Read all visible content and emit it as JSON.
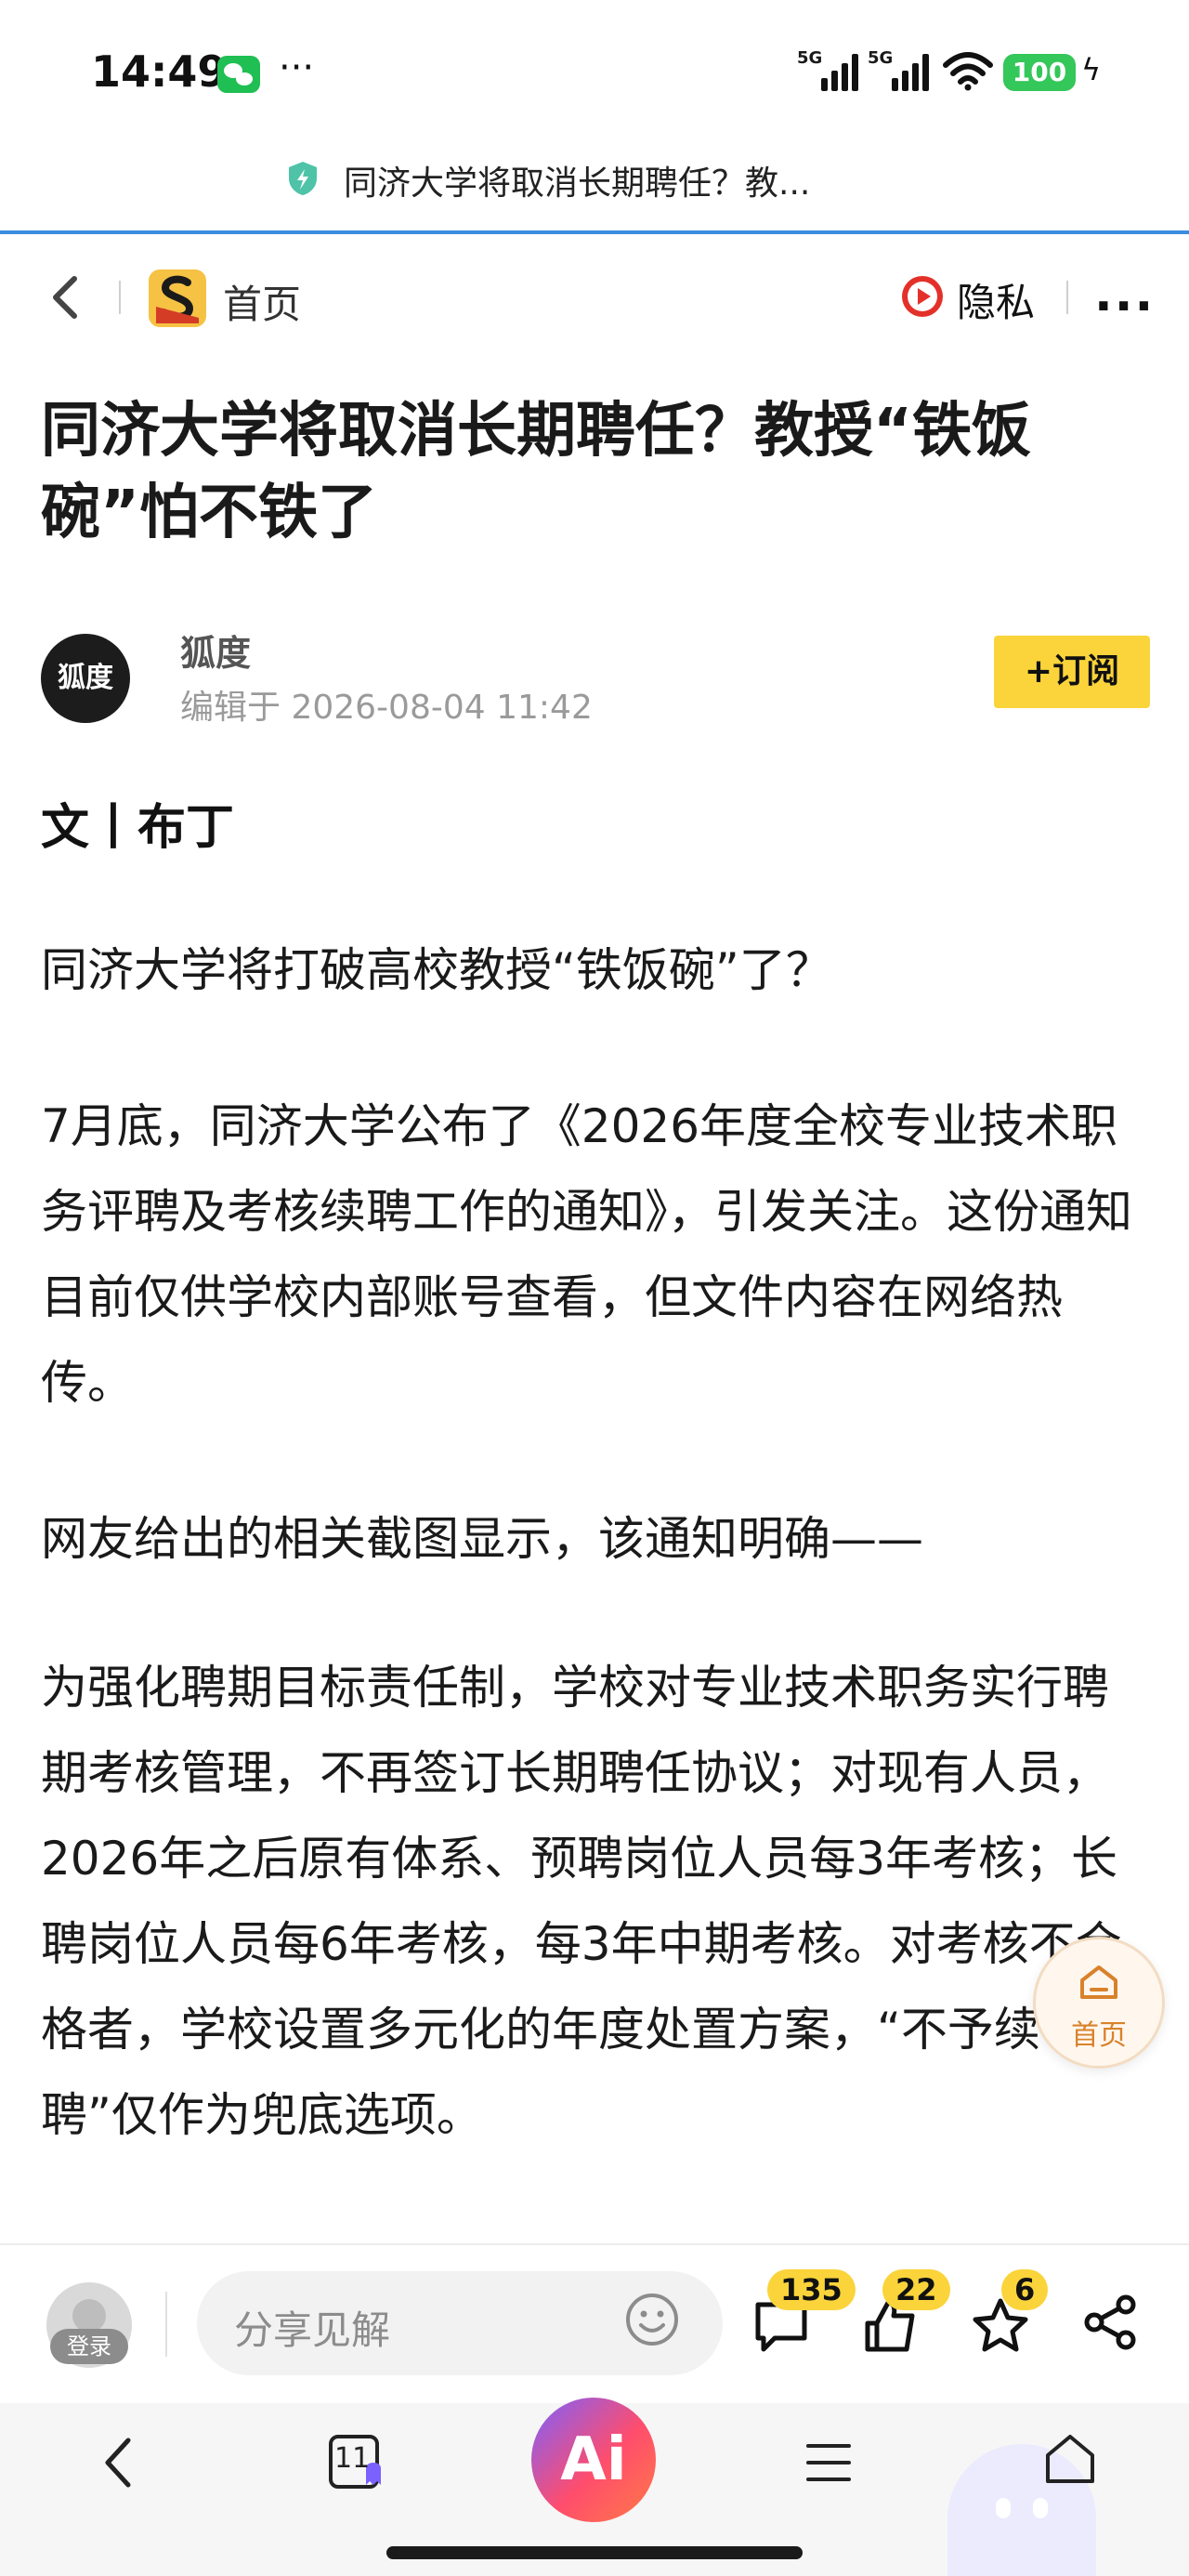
{
  "status_bar": {
    "time": "14:49",
    "more": "···",
    "signal1_label": "5G",
    "signal2_label": "5G",
    "battery": "100",
    "icons": [
      "wechat-icon",
      "signal-icon",
      "signal-icon",
      "wifi-icon",
      "battery-icon",
      "charging-icon"
    ]
  },
  "url_bar": {
    "text": "同济大学将取消长期聘任？教...",
    "icon": "shield-icon"
  },
  "header": {
    "home_label": "首页",
    "privacy_label": "隐私",
    "more": "···"
  },
  "article": {
    "title": "同济大学将取消长期聘任？教授“铁饭碗”怕不铁了",
    "author": "狐度",
    "author_avatar_text": "狐度",
    "edited": "编辑于 2026-08-04 11:42",
    "subscribe": "+订阅",
    "byline": "文丨布丁",
    "paragraphs": [
      "同济大学将打破高校教授“铁饭碗”了？",
      "7月底，同济大学公布了《2026年度全校专业技术职务评聘及考核续聘工作的通知》，引发关注。这份通知目前仅供学校内部账号查看，但文件内容在网络热传。",
      "网友给出的相关截图显示，该通知明确——",
      "为强化聘期目标责任制，学校对专业技术职务实行聘期考核管理，不再签订长期聘任协议；对现有人员，2026年之后原有体系、预聘岗位人员每3年考核；长聘岗位人员每6年考核，每3年中期考核。对考核不合格者，学校设置多元化的年度处置方案，“不予续聘”仅作为兜底选项。"
    ]
  },
  "float_home": {
    "label": "首页"
  },
  "comment_bar": {
    "login": "登录",
    "placeholder": "分享见解",
    "comments": "135",
    "likes": "22",
    "favorites": "6"
  },
  "system_nav": {
    "tabs_count": "11",
    "ai": "Ai"
  },
  "colors": {
    "accent_yellow": "#fad43a",
    "url_line": "#3c8de0",
    "battery": "#34c759",
    "float_home": "#d9822b"
  }
}
